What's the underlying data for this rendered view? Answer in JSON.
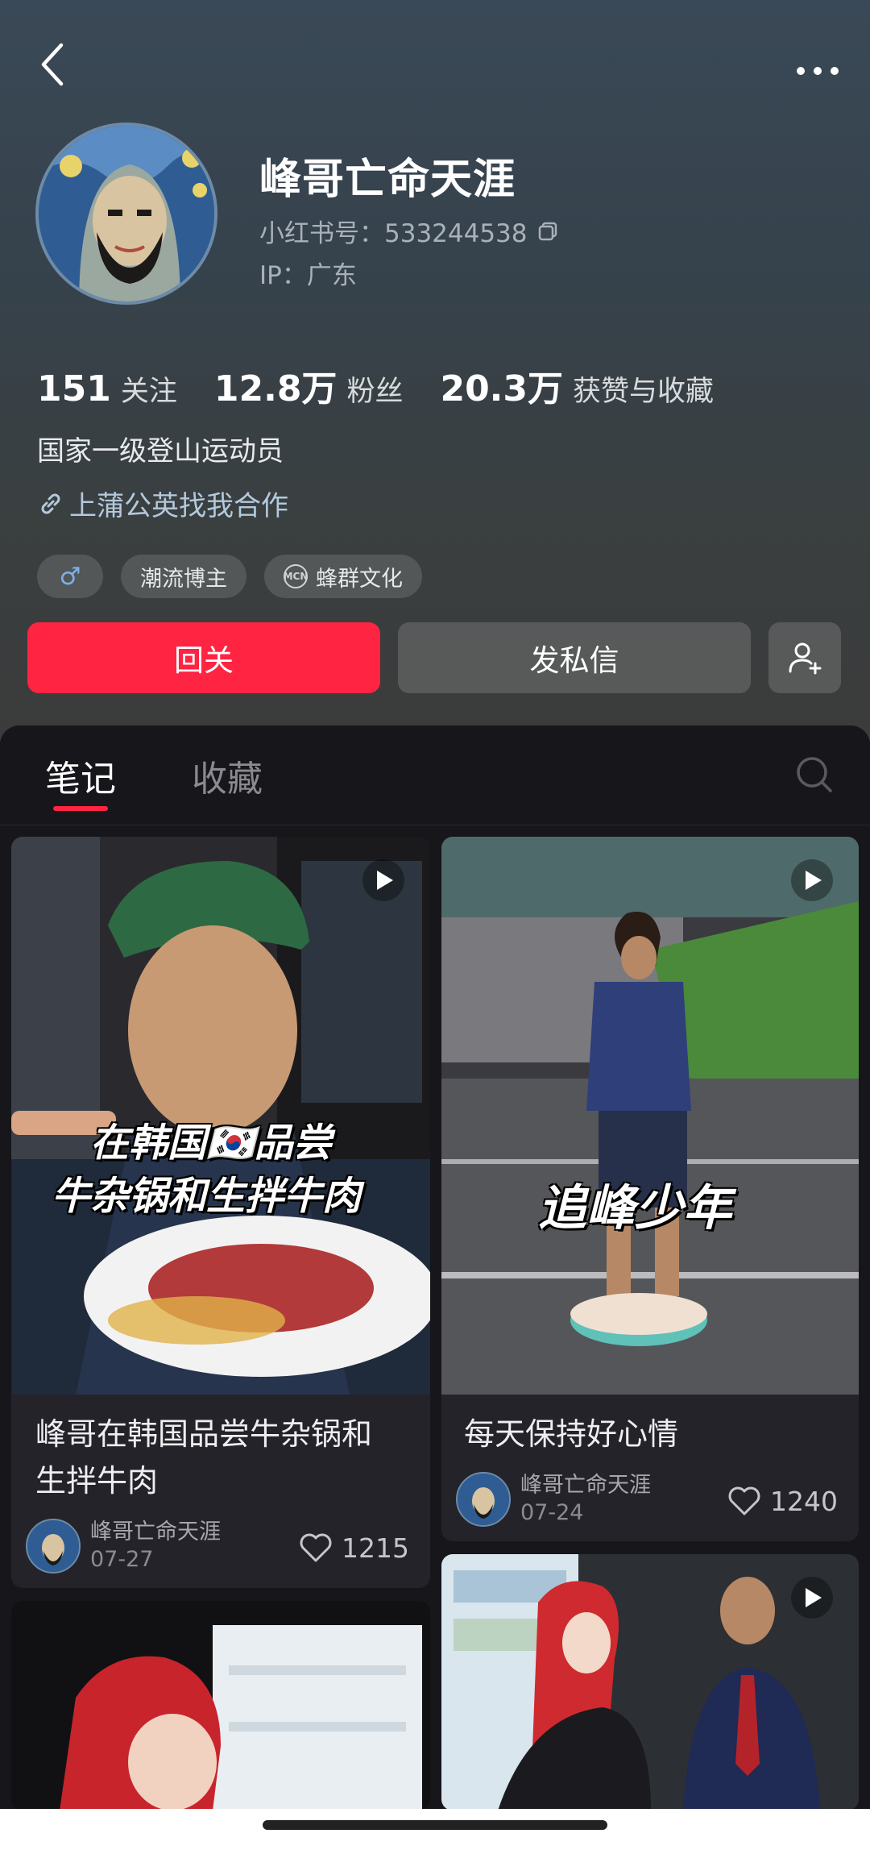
{
  "profile": {
    "username": "峰哥亡命天涯",
    "red_id": "小红书号：533244538",
    "ip": "IP：广东",
    "bio": "国家一级登山运动员",
    "link_text": "上蒲公英找我合作",
    "stats": [
      {
        "num": "151",
        "label": "关注"
      },
      {
        "num": "12.8万",
        "label": "粉丝"
      },
      {
        "num": "20.3万",
        "label": "获赞与收藏"
      }
    ],
    "tags": [
      {
        "label": "♂",
        "icon": "male-icon"
      },
      {
        "label": "潮流博主"
      },
      {
        "label": "蜂群文化",
        "icon": "mcn-icon",
        "badge": "MCN"
      }
    ]
  },
  "actions": {
    "follow_label": "回关",
    "message_label": "发私信"
  },
  "tabs": {
    "notes": "笔记",
    "collections": "收藏"
  },
  "notes": [
    {
      "title_line1": "峰哥在韩国品尝牛杂锅和",
      "title_line2": "生拌牛肉",
      "overlay_line1": "在韩国🇰🇷品尝",
      "overlay_line2": "牛杂锅和生拌牛肉",
      "author": "峰哥亡命天涯",
      "date": "07-27",
      "likes": "1215"
    },
    {
      "title_line1": "每天保持好心情",
      "overlay_line1": "追峰少年",
      "author": "峰哥亡命天涯",
      "date": "07-24",
      "likes": "1240"
    }
  ],
  "colors": {
    "accent": "#ff2442",
    "panel": "#16161b",
    "card": "#232329"
  }
}
